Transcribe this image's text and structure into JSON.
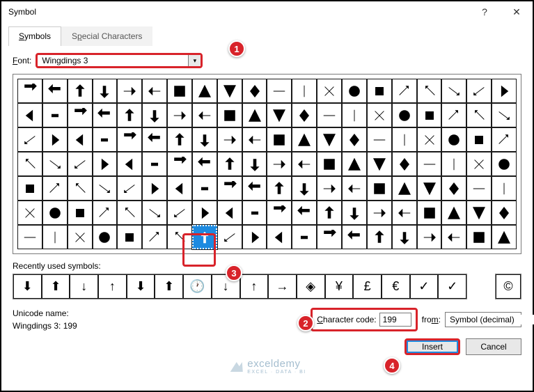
{
  "title": "Symbol",
  "tabs": {
    "symbols": "Symbols",
    "special": "Special Characters"
  },
  "labels": {
    "font": "Font:",
    "recent": "Recently used symbols:",
    "unicode": "Unicode name:",
    "charcode": "Character code:",
    "from": "from:"
  },
  "font_value": "Wingdings 3",
  "unicode_value": "Wingdings 3: 199",
  "charcode_value": "199",
  "from_value": "Symbol (decimal)",
  "buttons": {
    "insert": "Insert",
    "cancel": "Cancel"
  },
  "recent_glyphs": [
    "⬇",
    "⬆",
    "↓",
    "↑",
    "⬇",
    "⬆",
    "🕐",
    "↓",
    "↑",
    "→",
    "◈",
    "¥",
    "£",
    "€",
    "✓",
    "✓"
  ],
  "recent_extra": "©",
  "watermark": {
    "main": "exceldemy",
    "sub": "EXCEL · DATA · BI"
  }
}
